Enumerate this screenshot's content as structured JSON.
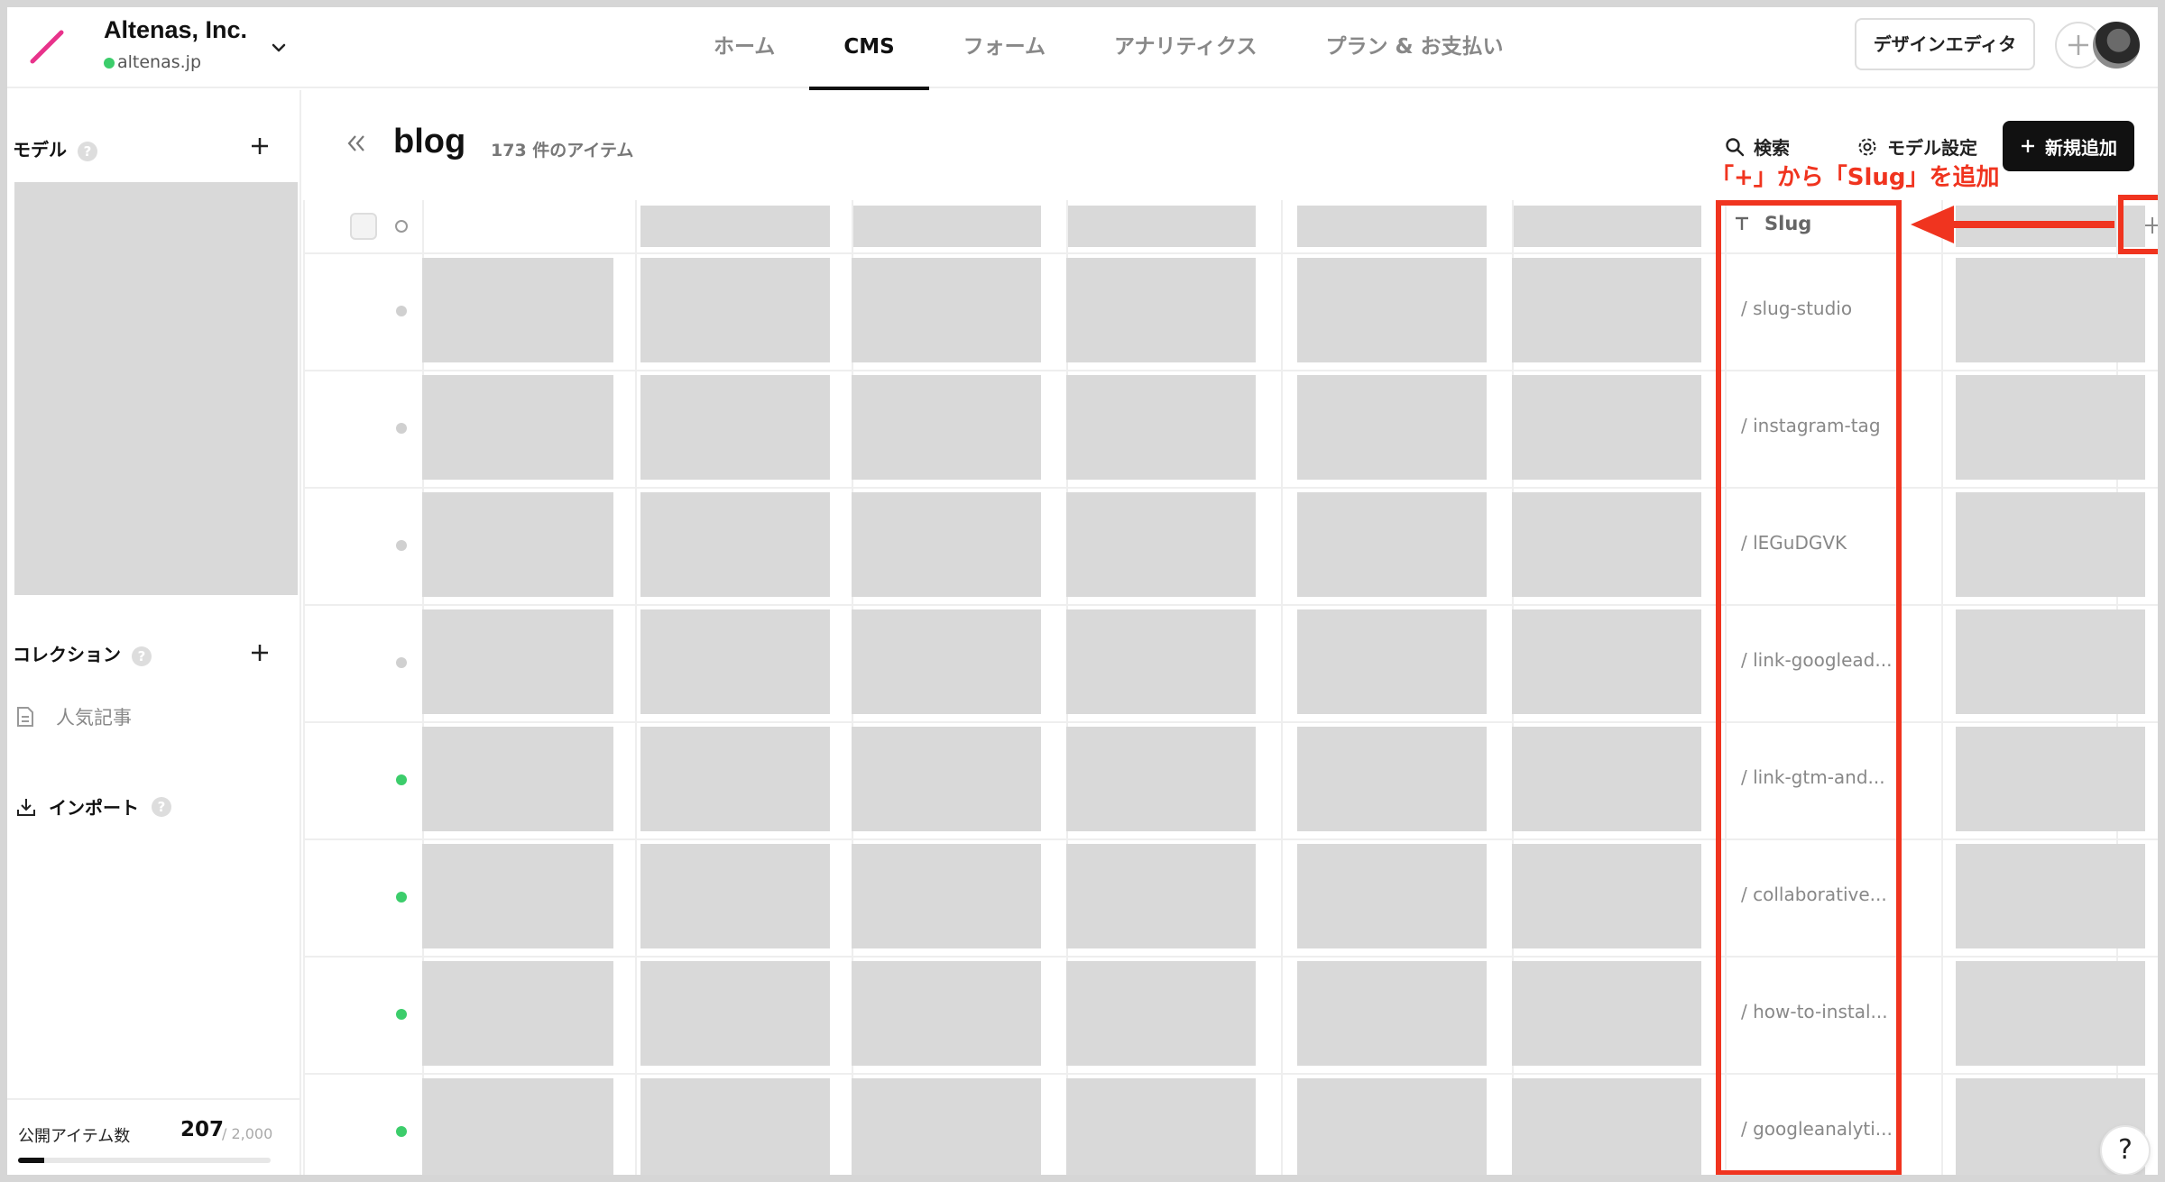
{
  "org": {
    "name": "Altenas, Inc.",
    "domain": "altenas.jp"
  },
  "nav": [
    {
      "label": "ホーム",
      "active": false
    },
    {
      "label": "CMS",
      "active": true
    },
    {
      "label": "フォーム",
      "active": false
    },
    {
      "label": "アナリティクス",
      "active": false
    },
    {
      "label": "プラン & お支払い",
      "active": false
    }
  ],
  "header_buttons": {
    "design_editor": "デザインエディタ"
  },
  "sidebar": {
    "models_label": "モデル",
    "help_glyph": "?",
    "collections_label": "コレクション",
    "collection_items": [
      "人気記事"
    ],
    "import_label": "インポート",
    "published": {
      "label": "公開アイテム数",
      "count": "207",
      "limit": "/ 2,000",
      "fraction": 0.1035
    }
  },
  "page": {
    "title": "blog",
    "item_count": "173 件のアイテム",
    "search_label": "検索",
    "model_settings_label": "モデル設定",
    "new_item_label": "新規追加"
  },
  "table": {
    "slug_header": "Slug",
    "rows": [
      {
        "published": false,
        "slug": "/ slug-studio"
      },
      {
        "published": false,
        "slug": "/ instagram-tag"
      },
      {
        "published": false,
        "slug": "/ lEGuDGVK"
      },
      {
        "published": false,
        "slug": "/ link-googlead..."
      },
      {
        "published": true,
        "slug": "/ link-gtm-and..."
      },
      {
        "published": true,
        "slug": "/ collaborative..."
      },
      {
        "published": true,
        "slug": "/ how-to-instal..."
      },
      {
        "published": true,
        "slug": "/ googleanalyti..."
      }
    ]
  },
  "annotation": {
    "text": "「+」から「Slug」を追加"
  },
  "help_fab": "?",
  "colors": {
    "accent": "#f0341f",
    "published_dot": "#3ccd6b",
    "draft_dot": "#d0d0d0",
    "logo": "#e8338b"
  },
  "icons": [
    "logo-icon",
    "chevron-down-icon",
    "plus-icon",
    "help-icon",
    "document-icon",
    "download-icon",
    "collapse-icon",
    "search-icon",
    "gear-icon",
    "text-type-icon",
    "arrow-left-icon"
  ]
}
